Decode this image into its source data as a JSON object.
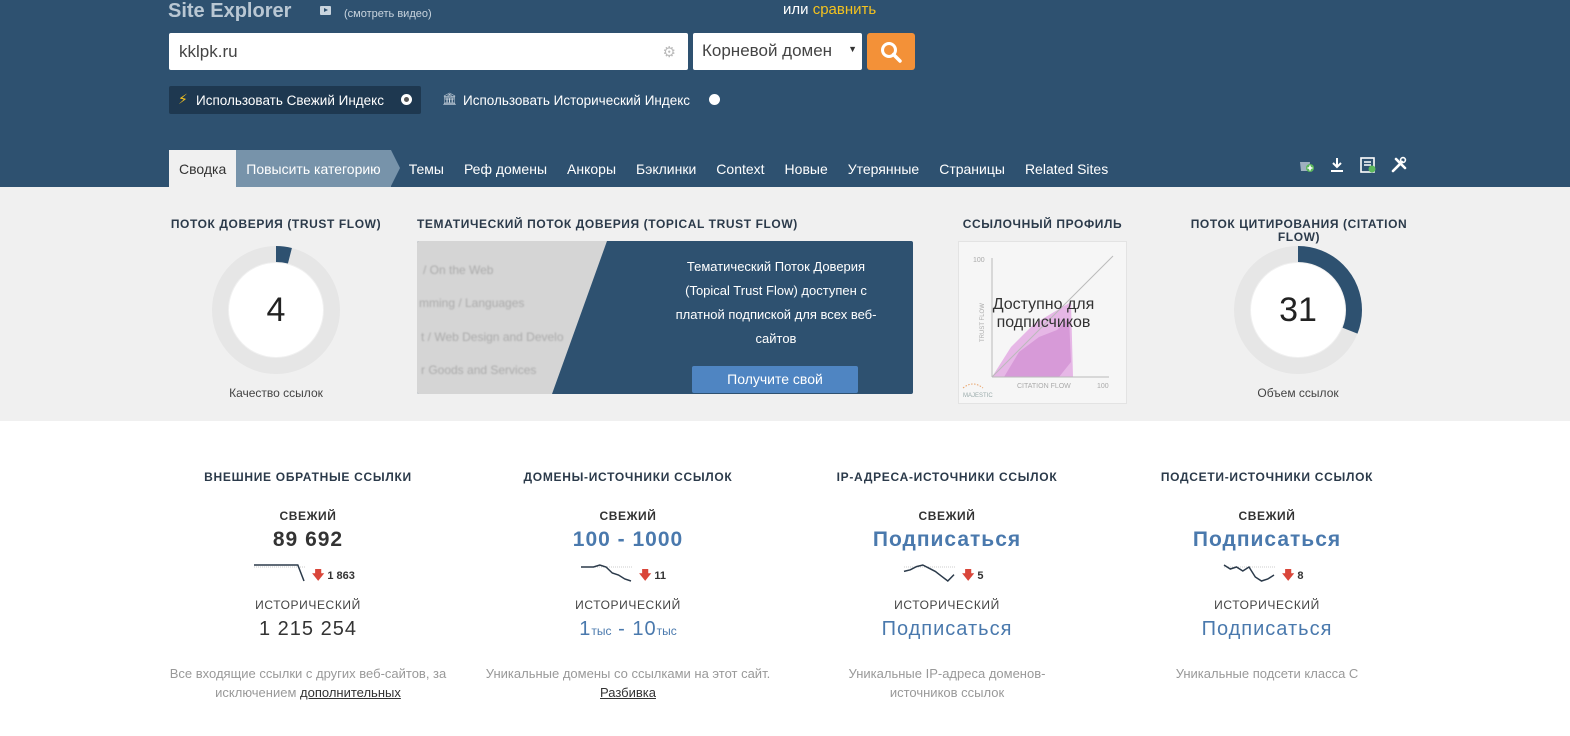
{
  "header": {
    "title": "Site Explorer",
    "video_link": "(смотреть видео)",
    "compare_prefix": "или",
    "compare_link": "сравнить",
    "search_value": "kklpk.ru",
    "scope_selected": "Корневой домен",
    "index_fresh": "Использовать Свежий Индекс",
    "index_historic": "Использовать Исторический Индекс",
    "accent_color": "#f39138",
    "background_color": "#2e5170"
  },
  "tabs": [
    {
      "label": "Сводка",
      "active": true
    },
    {
      "label": "Повысить категорию"
    },
    {
      "label": "Темы"
    },
    {
      "label": "Реф домены"
    },
    {
      "label": "Анкоры"
    },
    {
      "label": "Бэклинки"
    },
    {
      "label": "Context"
    },
    {
      "label": "Новые"
    },
    {
      "label": "Утерянные"
    },
    {
      "label": "Страницы"
    },
    {
      "label": "Related Sites"
    }
  ],
  "tool_icons": [
    "add-to-bucket-icon",
    "download-icon",
    "report-icon",
    "tools-icon"
  ],
  "metrics": {
    "trust_flow": {
      "title": "ПОТОК ДОВЕРИЯ (TRUST FLOW)",
      "value": "4",
      "fraction": 0.04,
      "caption": "Качество ссылок"
    },
    "topical_trust_flow": {
      "title": "ТЕМАТИЧЕСКИЙ ПОТОК ДОВЕРИЯ (TOPICAL TRUST FLOW)",
      "blurred_topics": [
        "/ On the Web",
        "mming / Languages",
        "t / Web Design and Develo",
        "r Goods and Services"
      ],
      "message": "Тематический Поток Доверия (Topical Trust Flow) доступен с платной подпиской для всех веб-сайтов",
      "button": "Получите свой"
    },
    "link_profile": {
      "title": "ССЫЛОЧНЫЙ ПРОФИЛЬ",
      "message": "Доступно для подписчиков",
      "axis_max": "100",
      "x_axis": "CITATION FLOW",
      "y_axis": "TRUST FLOW",
      "logo": "MAJESTIC"
    },
    "citation_flow": {
      "title": "ПОТОК ЦИТИРОВАНИЯ (CITATION FLOW)",
      "value": "31",
      "fraction": 0.31,
      "caption": "Объем ссылок"
    }
  },
  "stats": [
    {
      "title": "ВНЕШНИЕ ОБРАТНЫЕ ССЫЛКИ",
      "fresh_label": "СВЕЖИЙ",
      "fresh_value": "89 692",
      "delta": "1 863",
      "trend": [
        4,
        4,
        4,
        4,
        4,
        4,
        4,
        4,
        16
      ],
      "hist_label": "ИСТОРИЧЕСКИЙ",
      "hist_value": "1 215 254",
      "desc": "Все входящие ссылки с других веб-сайтов, за исключением",
      "desc_link": "дополнительных"
    },
    {
      "title": "ДОМЕНЫ-ИСТОЧНИКИ ССЫЛОК",
      "fresh_label": "СВЕЖИЙ",
      "fresh_value": "100 - 1000",
      "delta": "11",
      "trend": [
        5,
        5,
        5,
        4,
        5,
        8,
        9,
        11,
        12
      ],
      "hist_label": "ИСТОРИЧЕСКИЙ",
      "hist_parts": [
        "1",
        "тыс",
        " - 10",
        "тыс"
      ],
      "desc": "Уникальные домены со ссылками на этот сайт.",
      "desc_link": "Разбивка"
    },
    {
      "title": "IP-АДРЕСА-ИСТОЧНИКИ ССЫЛОК",
      "fresh_label": "СВЕЖИЙ",
      "fresh_value": "Подписаться",
      "delta": "5",
      "trend": [
        6,
        5,
        3,
        2,
        4,
        6,
        9,
        12,
        8
      ],
      "hist_label": "ИСТОРИЧЕСКИЙ",
      "hist_value": "Подписаться",
      "desc": "Уникальные IP-адреса доменов-источников ссылок"
    },
    {
      "title": "ПОДСЕТИ-ИСТОЧНИКИ ССЫЛОК",
      "fresh_label": "СВЕЖИЙ",
      "fresh_value": "Подписаться",
      "delta": "8",
      "trend": [
        5,
        7,
        6,
        8,
        6,
        11,
        13,
        12,
        10
      ],
      "hist_label": "ИСТОРИЧЕСКИЙ",
      "hist_value": "Подписаться",
      "desc": "Уникальные подсети класса С"
    }
  ]
}
